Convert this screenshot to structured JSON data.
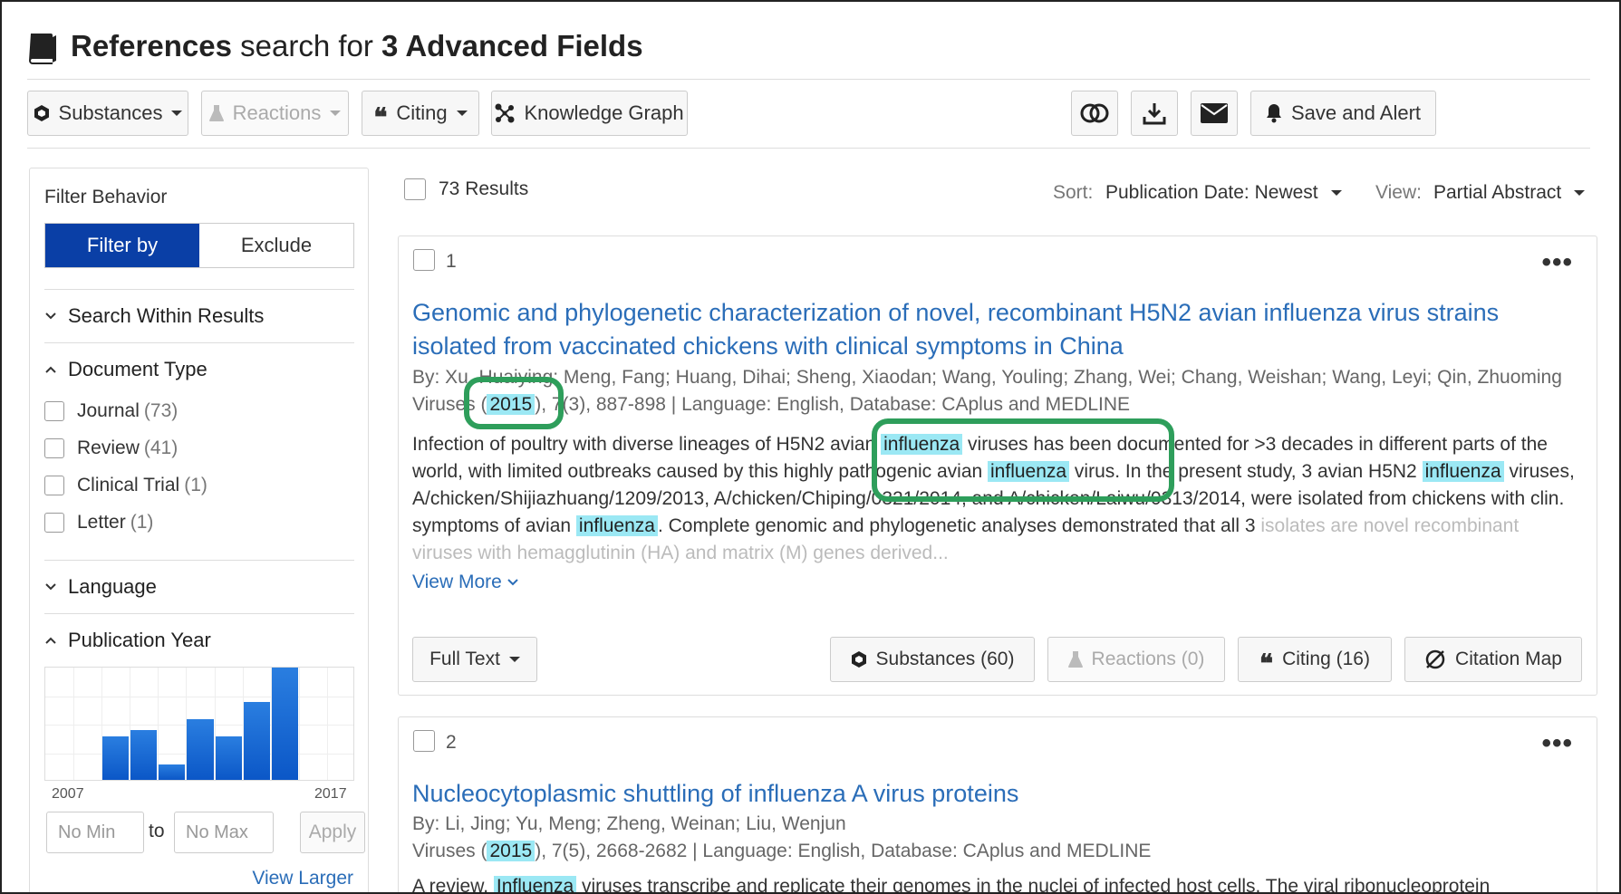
{
  "header": {
    "title_bold": "References",
    "title_mid": " search for ",
    "title_bold2": "3 Advanced Fields"
  },
  "toolbar": {
    "substances": "Substances",
    "reactions": "Reactions",
    "citing": "Citing",
    "knowledge_graph": "Knowledge Graph",
    "save_alert": "Save and Alert"
  },
  "sidebar": {
    "filter_behavior": "Filter Behavior",
    "filter_by": "Filter by",
    "exclude": "Exclude",
    "search_within": "Search Within Results",
    "document_type": "Document Type",
    "doc_types": [
      {
        "label": "Journal",
        "count": "(73)"
      },
      {
        "label": "Review",
        "count": "(41)"
      },
      {
        "label": "Clinical Trial",
        "count": "(1)"
      },
      {
        "label": "Letter",
        "count": "(1)"
      }
    ],
    "language": "Language",
    "publication_year": "Publication Year",
    "year_start": "2007",
    "year_end": "2017",
    "year_bars": [
      0,
      0,
      0.39,
      0.44,
      0.14,
      0.54,
      0.39,
      0.69,
      1.0,
      0,
      0
    ],
    "min_placeholder": "No Min",
    "to": "to",
    "max_placeholder": "No Max",
    "apply": "Apply",
    "view_larger": "View Larger"
  },
  "results": {
    "count": "73 Results",
    "sort_label": "Sort:",
    "sort_value": "Publication Date: Newest",
    "view_label": "View:",
    "view_value": "Partial Abstract",
    "items": [
      {
        "num": "1",
        "title": "Genomic and phylogenetic characterization of novel, recombinant H5N2 avian influenza virus strains isolated from vaccinated chickens with clinical symptoms in China",
        "authors": "By: Xu, Huaiying; Meng, Fang; Huang, Dihai; Sheng, Xiaodan; Wang, Youling; Zhang, Wei; Chang, Weishan; Wang, Leyi; Qin, Zhuoming",
        "source_pre": "Viruses (",
        "year": "2015",
        "source_post": "), 7(3), 887-898 | Language: English, Database: CAplus and MEDLINE",
        "abstract": [
          "Infection of poultry with diverse lineages of H5N2 avian ",
          "influenza",
          " viruses has been documented for >3 decades in different parts of the world, with limited outbreaks caused by this highly pathogenic avian ",
          "influenza",
          " virus. In the present study, 3 avian H5N2 ",
          "influenza",
          " viruses, A/chicken/Shijiazhuang/1209/2013, A/chicken/Chiping/0321/2014, and A/chicken/Laiwu/0313/2014, were isolated from chickens with clin. symptoms of avian ",
          "influenza",
          ". Complete genomic and phylogenetic analyses demonstrated that all 3 ",
          "isolates are novel recombinant viruses with hemagglutinin (HA) and matrix (M) genes derived..."
        ],
        "view_more": "View More",
        "full_text": "Full Text",
        "substances": "Substances (60)",
        "reactions": "Reactions (0)",
        "citing": "Citing (16)",
        "citation_map": "Citation Map"
      },
      {
        "num": "2",
        "title": "Nucleocytoplasmic shuttling of influenza A virus proteins",
        "authors": "By: Li, Jing; Yu, Meng; Zheng, Weinan; Liu, Wenjun",
        "source_pre": "Viruses (",
        "year": "2015",
        "source_post": "), 7(5), 2668-2682 | Language: English, Database: CAplus and MEDLINE",
        "abstract_pre": "A review. ",
        "abstract_hl": "Influenza",
        "abstract_post": " viruses transcribe and replicate their genomes in the nuclei of infected host cells. The viral ribonucleoprotein"
      }
    ]
  },
  "colors": {
    "accent": "#0a3fa6",
    "link": "#2a6db8",
    "highlight": "#9be8f4",
    "annotation": "#2e9e5b"
  }
}
